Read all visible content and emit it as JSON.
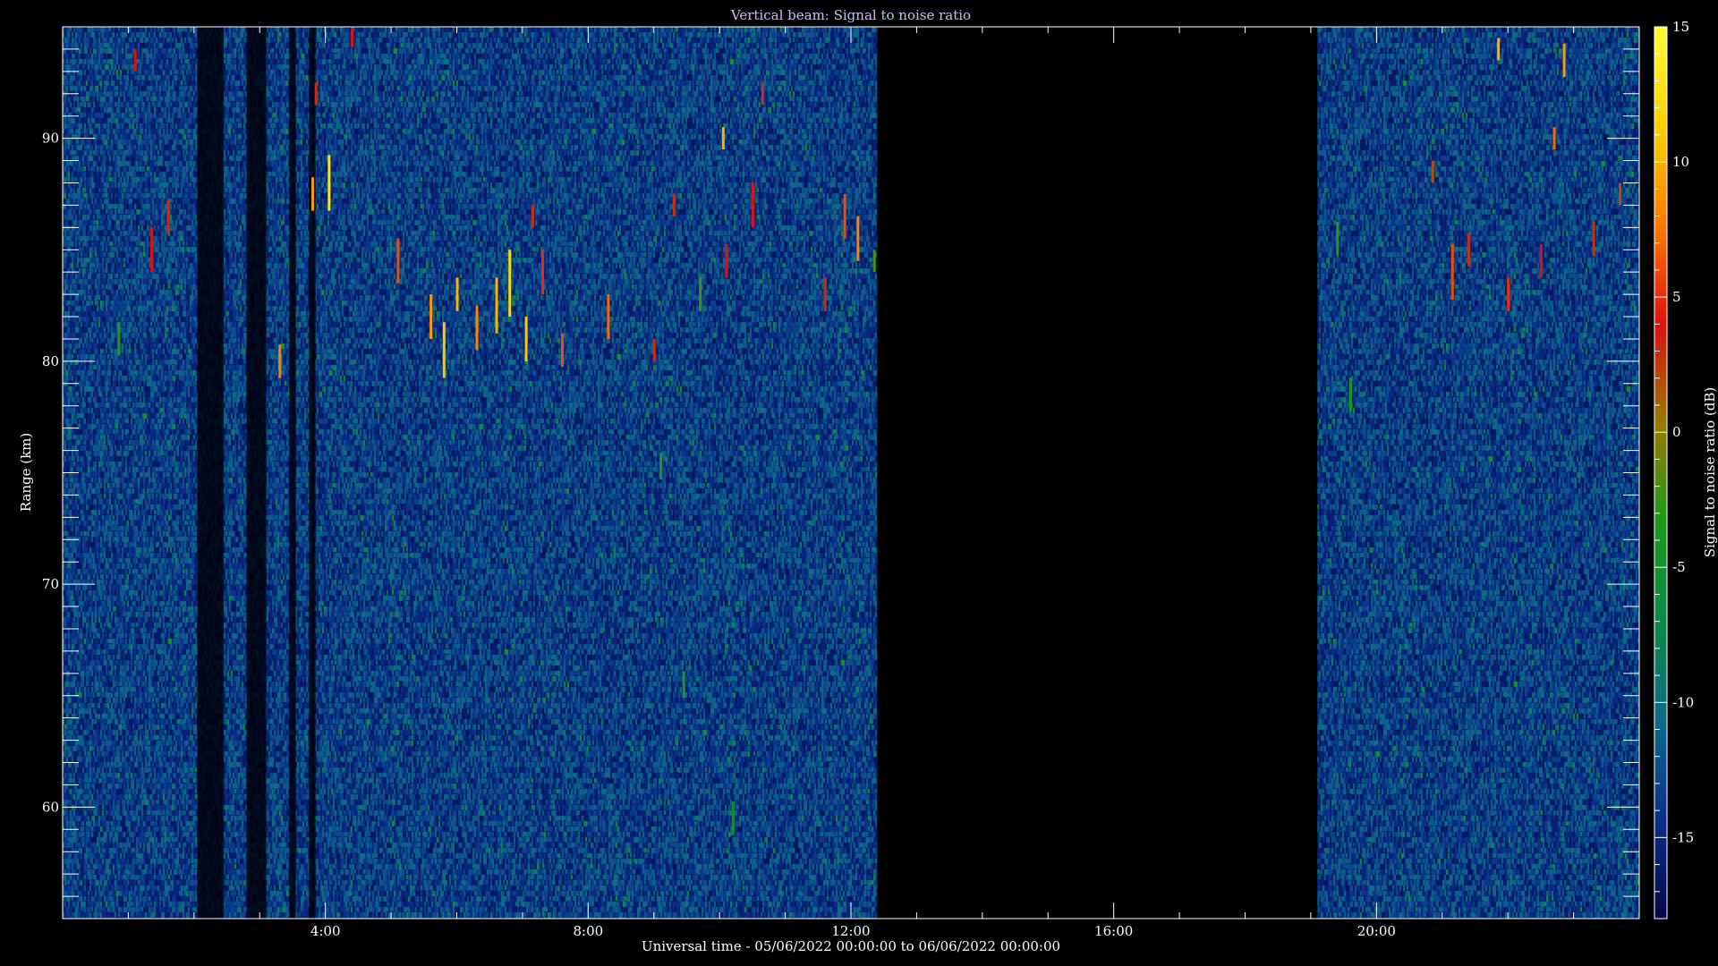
{
  "chart_data": {
    "type": "heatmap",
    "title": "Vertical beam: Signal to noise ratio",
    "xlabel": "Universal time - 05/06/2022 00:00:00 to 06/06/2022 00:00:00",
    "ylabel": "Range (km)",
    "x_unit": "hours UT",
    "xlim": [
      0,
      24
    ],
    "ylim": [
      55,
      95
    ],
    "x_ticks": [
      {
        "value": 4,
        "label": "4:00"
      },
      {
        "value": 8,
        "label": "8:00"
      },
      {
        "value": 12,
        "label": "12:00"
      },
      {
        "value": 16,
        "label": "16:00"
      },
      {
        "value": 20,
        "label": "20:00"
      }
    ],
    "y_ticks": [
      {
        "value": 60,
        "label": "60"
      },
      {
        "value": 70,
        "label": "70"
      },
      {
        "value": 80,
        "label": "80"
      },
      {
        "value": 90,
        "label": "90"
      }
    ],
    "colorbar": {
      "label": "Signal to noise ratio (dB)",
      "range": [
        -18,
        15
      ],
      "ticks": [
        {
          "value": 15,
          "label": "15"
        },
        {
          "value": 10,
          "label": "10"
        },
        {
          "value": 5,
          "label": "5"
        },
        {
          "value": 0,
          "label": "0"
        },
        {
          "value": -5,
          "label": "-5"
        },
        {
          "value": -10,
          "label": "-10"
        },
        {
          "value": -15,
          "label": "-15"
        }
      ],
      "colors": [
        "#07074a",
        "#0a2f8c",
        "#0d6a8a",
        "#0a8a4a",
        "#1a9a1a",
        "#9a7a00",
        "#e01010",
        "#ff7a00",
        "#ffd000",
        "#ffff33"
      ]
    },
    "background_level_db": -14,
    "data_gaps": [
      {
        "start": 12.4,
        "end": 19.1,
        "note": "no data"
      }
    ],
    "dark_columns": [
      {
        "start": 2.05,
        "end": 2.45
      },
      {
        "start": 2.8,
        "end": 3.1
      },
      {
        "start": 3.45,
        "end": 3.55
      },
      {
        "start": 3.75,
        "end": 3.85
      }
    ],
    "echoes": [
      {
        "time": 4.05,
        "range": 88.0,
        "extent": 2.5,
        "snr": 13
      },
      {
        "time": 3.8,
        "range": 87.5,
        "extent": 1.5,
        "snr": 9
      },
      {
        "time": 3.85,
        "range": 92.0,
        "extent": 1.0,
        "snr": 3
      },
      {
        "time": 3.3,
        "range": 80.0,
        "extent": 1.5,
        "snr": 8
      },
      {
        "time": 4.4,
        "range": 94.5,
        "extent": 0.8,
        "snr": 4
      },
      {
        "time": 5.1,
        "range": 84.5,
        "extent": 2.0,
        "snr": 6
      },
      {
        "time": 5.6,
        "range": 82.0,
        "extent": 2.0,
        "snr": 9
      },
      {
        "time": 5.8,
        "range": 80.5,
        "extent": 2.5,
        "snr": 11
      },
      {
        "time": 6.0,
        "range": 83.0,
        "extent": 1.5,
        "snr": 10
      },
      {
        "time": 6.3,
        "range": 81.5,
        "extent": 2.0,
        "snr": 8
      },
      {
        "time": 6.6,
        "range": 82.5,
        "extent": 2.5,
        "snr": 10
      },
      {
        "time": 6.8,
        "range": 83.5,
        "extent": 3.0,
        "snr": 12
      },
      {
        "time": 7.05,
        "range": 81.0,
        "extent": 2.0,
        "snr": 11
      },
      {
        "time": 7.3,
        "range": 84.0,
        "extent": 2.0,
        "snr": 5
      },
      {
        "time": 7.6,
        "range": 80.5,
        "extent": 1.5,
        "snr": 6
      },
      {
        "time": 7.15,
        "range": 86.5,
        "extent": 1.0,
        "snr": 3
      },
      {
        "time": 8.3,
        "range": 82.0,
        "extent": 2.0,
        "snr": 7
      },
      {
        "time": 9.0,
        "range": 80.5,
        "extent": 1.0,
        "snr": 3
      },
      {
        "time": 9.1,
        "range": 75.3,
        "extent": 1.2,
        "snr": -4
      },
      {
        "time": 9.3,
        "range": 87.0,
        "extent": 1.0,
        "snr": 3
      },
      {
        "time": 9.7,
        "range": 83.0,
        "extent": 1.5,
        "snr": -2
      },
      {
        "time": 10.1,
        "range": 84.5,
        "extent": 1.5,
        "snr": 4
      },
      {
        "time": 10.05,
        "range": 90.0,
        "extent": 1.0,
        "snr": 10
      },
      {
        "time": 10.5,
        "range": 87.0,
        "extent": 2.0,
        "snr": 4
      },
      {
        "time": 10.65,
        "range": 92.0,
        "extent": 1.0,
        "snr": 3
      },
      {
        "time": 9.45,
        "range": 65.5,
        "extent": 1.2,
        "snr": -4
      },
      {
        "time": 10.2,
        "range": 59.5,
        "extent": 1.5,
        "snr": -6
      },
      {
        "time": 11.6,
        "range": 83.0,
        "extent": 1.5,
        "snr": 3
      },
      {
        "time": 11.9,
        "range": 86.5,
        "extent": 2.0,
        "snr": 6
      },
      {
        "time": 12.1,
        "range": 85.5,
        "extent": 2.0,
        "snr": 8
      },
      {
        "time": 12.35,
        "range": 84.5,
        "extent": 1.0,
        "snr": -2
      },
      {
        "time": 1.35,
        "range": 85.0,
        "extent": 2.0,
        "snr": 4
      },
      {
        "time": 1.1,
        "range": 93.5,
        "extent": 1.0,
        "snr": 4
      },
      {
        "time": 0.85,
        "range": 81.0,
        "extent": 1.5,
        "snr": -3
      },
      {
        "time": 1.6,
        "range": 86.5,
        "extent": 1.5,
        "snr": 3
      },
      {
        "time": 19.4,
        "range": 85.5,
        "extent": 1.5,
        "snr": -3
      },
      {
        "time": 19.6,
        "range": 78.5,
        "extent": 1.5,
        "snr": -4
      },
      {
        "time": 20.85,
        "range": 88.5,
        "extent": 1.0,
        "snr": 2
      },
      {
        "time": 21.15,
        "range": 84.0,
        "extent": 2.5,
        "snr": 6
      },
      {
        "time": 21.4,
        "range": 85.0,
        "extent": 1.5,
        "snr": 3
      },
      {
        "time": 22.0,
        "range": 83.0,
        "extent": 1.5,
        "snr": 5
      },
      {
        "time": 22.5,
        "range": 84.5,
        "extent": 1.5,
        "snr": 4
      },
      {
        "time": 22.7,
        "range": 90.0,
        "extent": 1.0,
        "snr": 7
      },
      {
        "time": 22.85,
        "range": 93.5,
        "extent": 1.5,
        "snr": 9
      },
      {
        "time": 21.85,
        "range": 94.0,
        "extent": 1.0,
        "snr": 10
      },
      {
        "time": 23.7,
        "range": 87.5,
        "extent": 1.0,
        "snr": 2
      },
      {
        "time": 23.3,
        "range": 85.5,
        "extent": 1.5,
        "snr": 3
      }
    ]
  }
}
